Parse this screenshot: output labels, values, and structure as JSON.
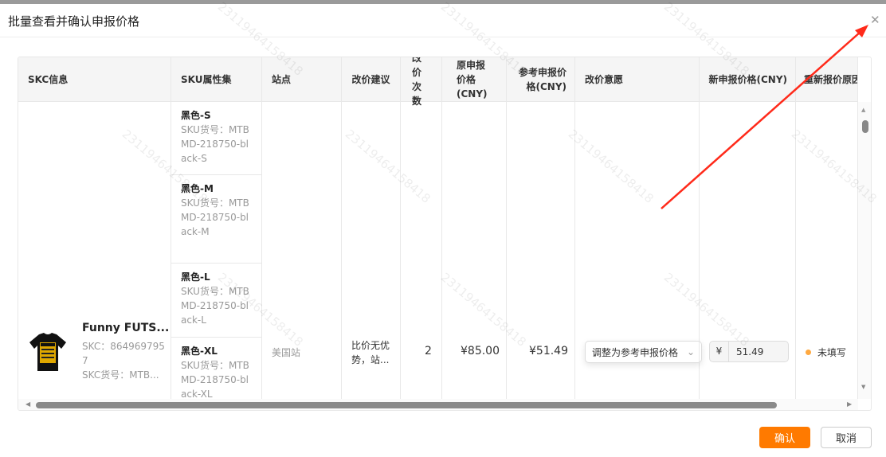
{
  "dialog": {
    "title": "批量查看并确认申报价格",
    "confirm": "确认",
    "cancel": "取消"
  },
  "watermark": "23119464158418",
  "columns": [
    "SKC信息",
    "SKU属性集",
    "站点",
    "改价建议",
    "改价次数",
    "原申报价格(CNY)",
    "参考申报价格(CNY)",
    "改价意愿",
    "新申报价格(CNY)",
    "重新报价原因"
  ],
  "row": {
    "product_name": "Funny FUTS...",
    "skc": "SKC：8649697957",
    "skc_code": "SKC货号：MTB...",
    "site": "美国站",
    "suggestion": "比价无优势，站...",
    "count": "2",
    "orig_price": "¥85.00",
    "ref_price": "¥51.49",
    "intent": "调整为参考申报价格",
    "currency": "¥",
    "new_price": "51.49",
    "reason_status": "未填写",
    "skus": [
      {
        "name": "黑色-S",
        "code": "SKU货号：MTBMD-218750-black-S"
      },
      {
        "name": "黑色-M",
        "code": "SKU货号：MTBMD-218750-black-M"
      },
      {
        "name": "黑色-L",
        "code": "SKU货号：MTBMD-218750-black-L"
      },
      {
        "name": "黑色-XL",
        "code": "SKU货号：MTBMD-218750-black-XL"
      }
    ]
  },
  "colors": {
    "accent": "#ff7a00",
    "status_dot": "#ffa940",
    "annotation": "#ff2a1a"
  }
}
